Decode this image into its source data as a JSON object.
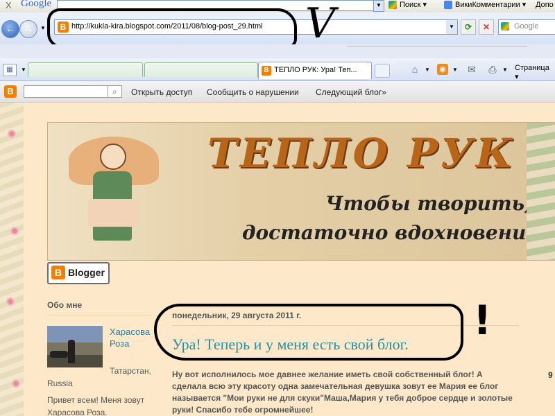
{
  "toolbar_google": {
    "close": "X",
    "logo": "Google",
    "search_btn": "Поиск",
    "wiki_btn": "ВикиКомментарии",
    "more_btn": "Допо"
  },
  "address_bar": {
    "url": "http://kukla-kira.blogspot.com/2011/08/blog-post_29.html",
    "search_placeholder": "Google"
  },
  "tabs": {
    "active_label": "ТЕПЛО РУК: Ура! Теп...",
    "page_menu": "Страница"
  },
  "blogger_navbar": {
    "links": [
      "Открыть доступ",
      "Сообщить о нарушении",
      "Следующий блог»"
    ]
  },
  "header": {
    "title": "ТЕПЛО РУК",
    "subtitle_1": "Чтобы творить,",
    "subtitle_2": "достаточно вдохновения"
  },
  "blogger_badge": "Blogger",
  "sidebar": {
    "title": "Обо мне",
    "profile_name": "Харасова Роза",
    "location": "Татарстан, Russia",
    "about": "Привет всем! Меня зовут Харасова Роза."
  },
  "post": {
    "date": "понедельник, 29 августа 2011 г.",
    "title": "Ура! Теперь и у меня есть свой блог.",
    "body": "Ну вот исполнилось мое давнее желание иметь свой собственный блог! А сделала всю эту красоту одна замечательная девушка зовут ее Мария ее блог называется \"Мои руки не для скуки\"Маша,Мария у тебя доброе сердце и золотые руки! Спасибо тебе огромнейшее!"
  },
  "annotations": {
    "check_mark": "V",
    "exclamation": "!",
    "edge_digit": "9"
  },
  "colors": {
    "page_bg": "#fde9c9",
    "post_title": "#2a8fa0",
    "blogger_orange": "#f57d00"
  }
}
